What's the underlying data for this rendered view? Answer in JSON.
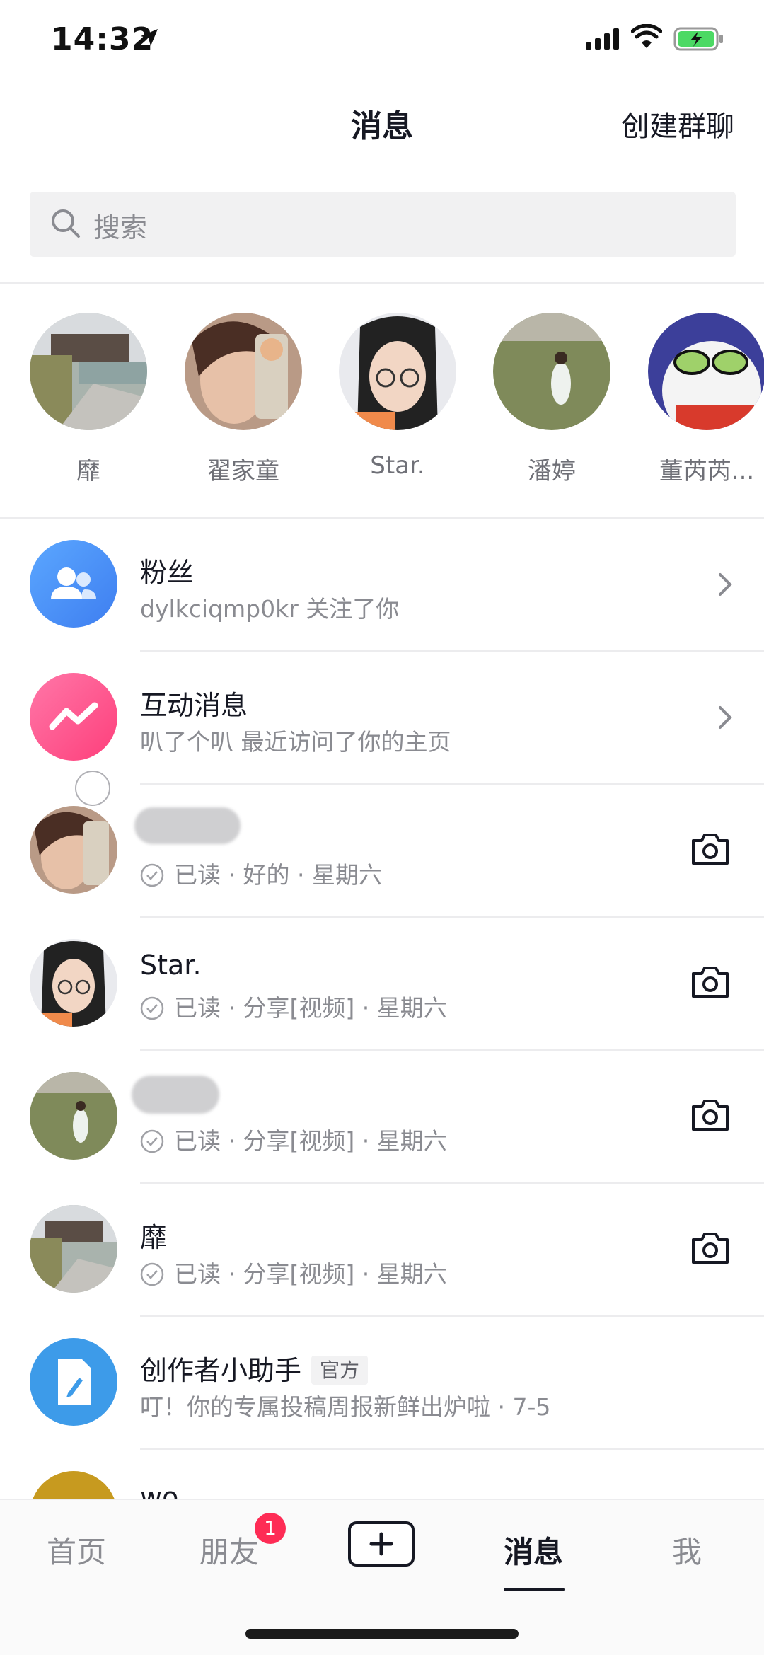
{
  "status_bar": {
    "time": "14:32"
  },
  "header": {
    "title": "消息",
    "create_group": "创建群聊"
  },
  "search": {
    "placeholder": "搜索"
  },
  "stories": [
    {
      "name": "靡"
    },
    {
      "name": "翟家童"
    },
    {
      "name": "Star."
    },
    {
      "name": "潘婷"
    },
    {
      "name": "董芮芮..."
    }
  ],
  "rows": [
    {
      "title": "粉丝",
      "subtitle": "dylkciqmp0kr 关注了你",
      "icon": "fans-icon",
      "color": "#4f93f7"
    },
    {
      "title": "互动消息",
      "subtitle": "叭了个叭 最近访问了你的主页",
      "icon": "interaction-icon",
      "color": "#fe5c8f"
    },
    {
      "title": "",
      "subtitle": "已读 · 好的 · 星期六"
    },
    {
      "title": "Star.",
      "subtitle": "已读 · 分享[视频] · 星期六"
    },
    {
      "title": "",
      "subtitle": "已读 · 分享[视频] · 星期六"
    },
    {
      "title": "靡",
      "subtitle": "已读 · 分享[视频] · 星期六"
    },
    {
      "title": "创作者小助手",
      "tag": "官方",
      "subtitle": "叮！你的专属投稿周报新鲜出炉啦 · 7-5",
      "icon": "edit-icon",
      "color": "#3d9be9"
    },
    {
      "title": "wo"
    }
  ],
  "tabbar": {
    "home": "首页",
    "friends": "朋友",
    "friends_badge": "1",
    "messages": "消息",
    "me": "我"
  },
  "colors": {
    "badge": "#fe2c55",
    "text": "#161823",
    "secondary": "#8a8b91"
  }
}
